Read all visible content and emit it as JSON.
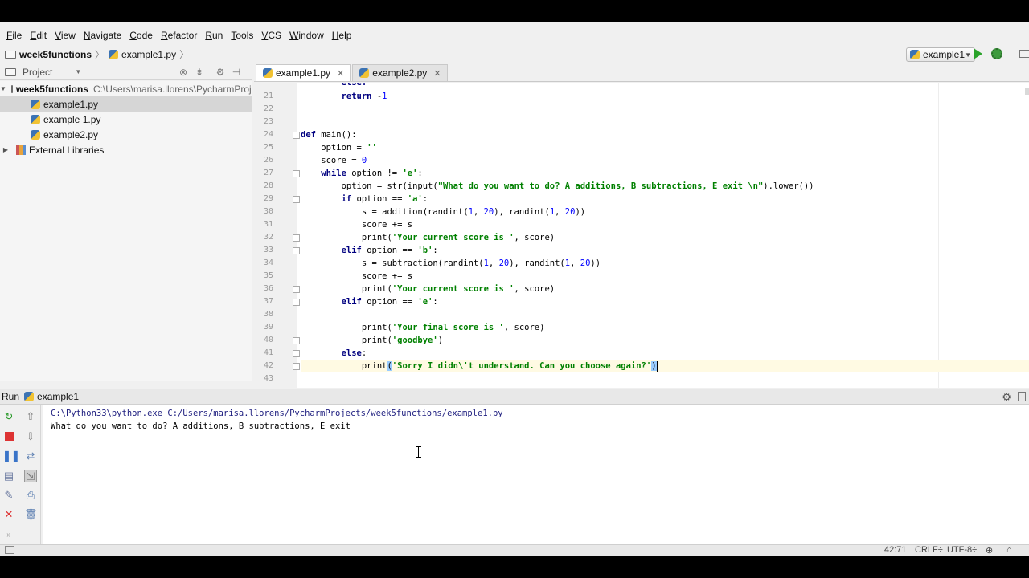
{
  "menu": {
    "items": [
      {
        "ul": "F",
        "rest": "ile"
      },
      {
        "ul": "E",
        "rest": "dit"
      },
      {
        "ul": "V",
        "rest": "iew"
      },
      {
        "ul": "N",
        "rest": "avigate"
      },
      {
        "ul": "C",
        "rest": "ode"
      },
      {
        "ul": "R",
        "rest": "efactor"
      },
      {
        "ul": "R",
        "rest": "un"
      },
      {
        "ul": "T",
        "rest": "ools"
      },
      {
        "ul": "V",
        "rest": "CS"
      },
      {
        "ul": "W",
        "rest": "indow"
      },
      {
        "ul": "H",
        "rest": "elp"
      }
    ]
  },
  "nav": {
    "project": "week5functions",
    "file": "example1.py"
  },
  "toolbar": {
    "run_config": "example1"
  },
  "project_panel": {
    "title": "Project",
    "root_name": "week5functions",
    "root_path": "C:\\Users\\marisa.llorens\\PycharmProje",
    "files": [
      "example1.py",
      "example 1.py",
      "example2.py"
    ],
    "libraries": "External Libraries"
  },
  "tabs": [
    {
      "label": "example1.py",
      "active": true
    },
    {
      "label": "example2.py",
      "active": false
    }
  ],
  "editor": {
    "current_line": 42,
    "lines": [
      {
        "n": "21",
        "code": [
          [
            "        ",
            ""
          ],
          [
            "return",
            "k"
          ],
          [
            " -",
            ""
          ],
          [
            "1",
            "n"
          ]
        ]
      },
      {
        "n": "22",
        "code": []
      },
      {
        "n": "23",
        "code": []
      },
      {
        "n": "24",
        "code": [
          [
            "def",
            "k"
          ],
          [
            " main():",
            ""
          ]
        ]
      },
      {
        "n": "25",
        "code": [
          [
            "    option = ",
            ""
          ],
          [
            "''",
            "s"
          ]
        ]
      },
      {
        "n": "26",
        "code": [
          [
            "    score = ",
            ""
          ],
          [
            "0",
            "n"
          ]
        ]
      },
      {
        "n": "27",
        "code": [
          [
            "    ",
            ""
          ],
          [
            "while",
            "k"
          ],
          [
            " option != ",
            ""
          ],
          [
            "'e'",
            "s"
          ],
          [
            ":",
            ""
          ]
        ]
      },
      {
        "n": "28",
        "code": [
          [
            "        option = str(input(",
            ""
          ],
          [
            "\"What do you want to do? A additions, B subtractions, E exit \\n\"",
            "s"
          ],
          [
            ").lower())",
            ""
          ]
        ]
      },
      {
        "n": "29",
        "code": [
          [
            "        ",
            ""
          ],
          [
            "if",
            "k"
          ],
          [
            " option == ",
            ""
          ],
          [
            "'a'",
            "s"
          ],
          [
            ":",
            ""
          ]
        ]
      },
      {
        "n": "30",
        "code": [
          [
            "            s = addition(randint(",
            ""
          ],
          [
            "1",
            "n"
          ],
          [
            ", ",
            ""
          ],
          [
            "20",
            "n"
          ],
          [
            "), randint(",
            ""
          ],
          [
            "1",
            "n"
          ],
          [
            ", ",
            ""
          ],
          [
            "20",
            "n"
          ],
          [
            "))",
            ""
          ]
        ]
      },
      {
        "n": "31",
        "code": [
          [
            "            score += s",
            ""
          ]
        ]
      },
      {
        "n": "32",
        "code": [
          [
            "            print(",
            ""
          ],
          [
            "'Your current score is '",
            "s"
          ],
          [
            ", score)",
            ""
          ]
        ]
      },
      {
        "n": "33",
        "code": [
          [
            "        ",
            ""
          ],
          [
            "elif",
            "k"
          ],
          [
            " option == ",
            ""
          ],
          [
            "'b'",
            "s"
          ],
          [
            ":",
            ""
          ]
        ]
      },
      {
        "n": "34",
        "code": [
          [
            "            s = subtraction(randint(",
            ""
          ],
          [
            "1",
            "n"
          ],
          [
            ", ",
            ""
          ],
          [
            "20",
            "n"
          ],
          [
            "), randint(",
            ""
          ],
          [
            "1",
            "n"
          ],
          [
            ", ",
            ""
          ],
          [
            "20",
            "n"
          ],
          [
            "))",
            ""
          ]
        ]
      },
      {
        "n": "35",
        "code": [
          [
            "            score += s",
            ""
          ]
        ]
      },
      {
        "n": "36",
        "code": [
          [
            "            print(",
            ""
          ],
          [
            "'Your current score is '",
            "s"
          ],
          [
            ", score)",
            ""
          ]
        ]
      },
      {
        "n": "37",
        "code": [
          [
            "        ",
            ""
          ],
          [
            "elif",
            "k"
          ],
          [
            " option == ",
            ""
          ],
          [
            "'e'",
            "s"
          ],
          [
            ":",
            ""
          ]
        ]
      },
      {
        "n": "38",
        "code": []
      },
      {
        "n": "39",
        "code": [
          [
            "            print(",
            ""
          ],
          [
            "'Your final score is '",
            "s"
          ],
          [
            ", score)",
            ""
          ]
        ]
      },
      {
        "n": "40",
        "code": [
          [
            "            print(",
            ""
          ],
          [
            "'goodbye'",
            "s"
          ],
          [
            ")",
            ""
          ]
        ]
      },
      {
        "n": "41",
        "code": [
          [
            "        ",
            ""
          ],
          [
            "else",
            "k"
          ],
          [
            ":",
            ""
          ]
        ]
      },
      {
        "n": "42",
        "code": [
          [
            "            print",
            ""
          ],
          [
            "(",
            "hl"
          ],
          [
            "'Sorry I didn\\'t understand. Can you choose again?'",
            "s"
          ],
          [
            ")",
            "hl"
          ]
        ]
      },
      {
        "n": "43",
        "code": []
      }
    ],
    "partial_top": "        else:"
  },
  "run_panel": {
    "label": "Run",
    "config": "example1",
    "console": [
      {
        "text": "C:\\Python33\\python.exe C:/Users/marisa.llorens/PycharmProjects/week5functions/example1.py",
        "kind": "cmd"
      },
      {
        "text": "What do you want to do? A additions, B subtractions, E exit",
        "kind": "out"
      }
    ]
  },
  "status": {
    "position": "42:71",
    "line_ending": "CRLF÷",
    "encoding": "UTF-8÷"
  },
  "colors": {
    "keyword": "#000080",
    "string": "#008000",
    "number": "#0000ff",
    "current_line": "#fffae3",
    "run_green": "#2aa32a"
  }
}
